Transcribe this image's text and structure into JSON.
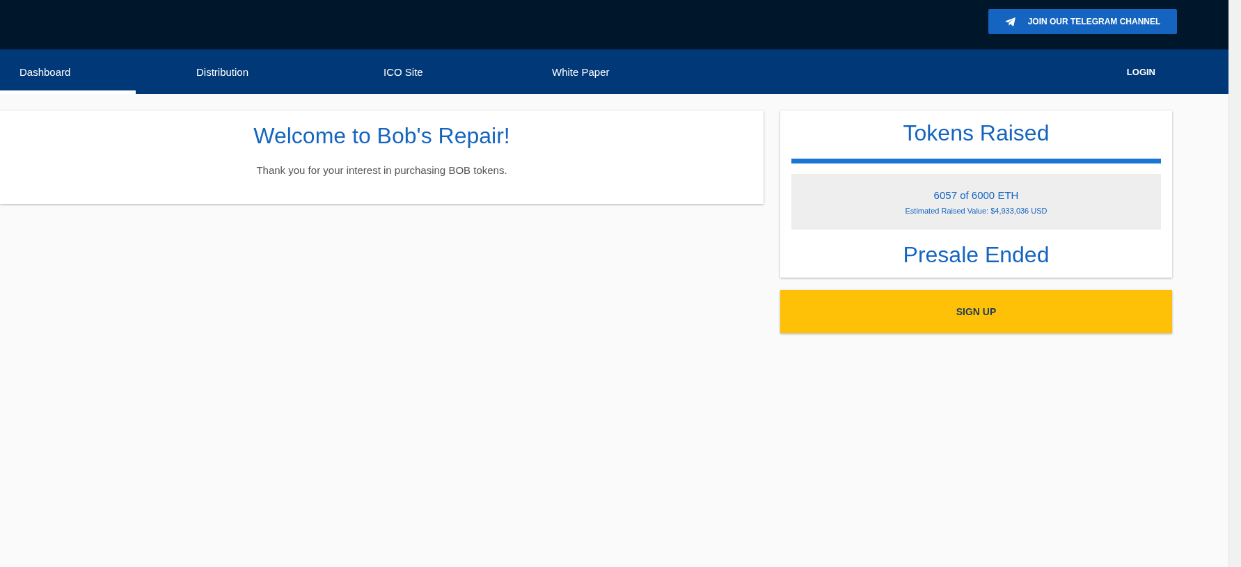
{
  "header": {
    "telegram_button": "JOIN OUR TELEGRAM CHANNEL"
  },
  "nav": {
    "tabs": [
      {
        "label": "Dashboard",
        "selected": true
      },
      {
        "label": "Distribution",
        "selected": false
      },
      {
        "label": "ICO Site",
        "selected": false
      },
      {
        "label": "White Paper",
        "selected": false
      }
    ],
    "login": "LOGIN"
  },
  "welcome": {
    "title": "Welcome to Bob's Repair!",
    "text": "Thank you for your interest in purchasing BOB tokens."
  },
  "tokens": {
    "title": "Tokens Raised",
    "level": 1,
    "raised": "6057",
    "of": "of",
    "goal": "6000 ETH",
    "estimate": "Estimated Raised Value: $4,933,036 USD",
    "status": "Presale Ended"
  },
  "signup_button": "SIGN UP"
}
